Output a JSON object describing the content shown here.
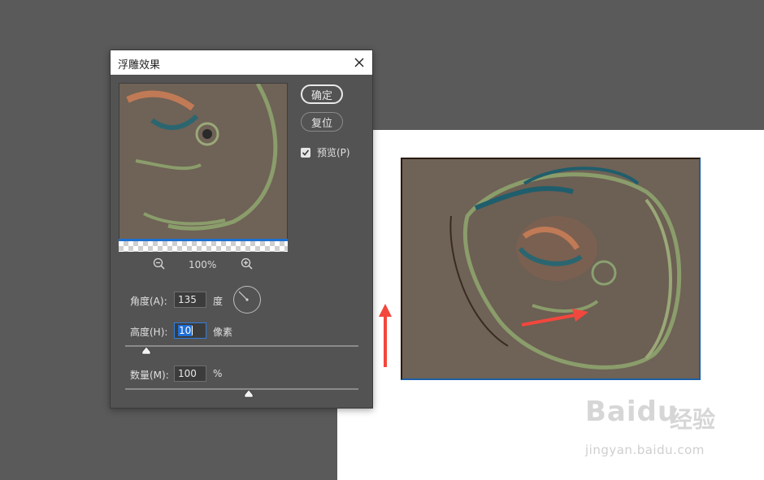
{
  "dialog": {
    "title": "浮雕效果",
    "ok_label": "确定",
    "reset_label": "复位",
    "preview_label": "预览(P)",
    "preview_checked": true,
    "zoom_value": "100%",
    "angle": {
      "label": "角度(A):",
      "value": "135",
      "unit": "度"
    },
    "height": {
      "label": "高度(H):",
      "value": "10",
      "unit": "像素",
      "slider_fraction": 0.09
    },
    "amount": {
      "label": "数量(M):",
      "value": "100",
      "unit": "%",
      "slider_fraction": 0.53
    }
  },
  "watermark": {
    "logo": "Baidu",
    "brand_cn": "经验",
    "url": "jingyan.baidu.com"
  },
  "icons": [
    "close-icon",
    "zoom-out-icon",
    "zoom-in-icon",
    "checkmark-icon",
    "angle-dial-icon",
    "slider-thumb-icon",
    "red-arrow"
  ],
  "colors": {
    "dialog_bg": "#535353",
    "workspace_bg": "#5a5a5a",
    "accent_blue": "#1e6fd0",
    "arrow_red": "#f2473d",
    "image_tone": "#6f6256"
  }
}
